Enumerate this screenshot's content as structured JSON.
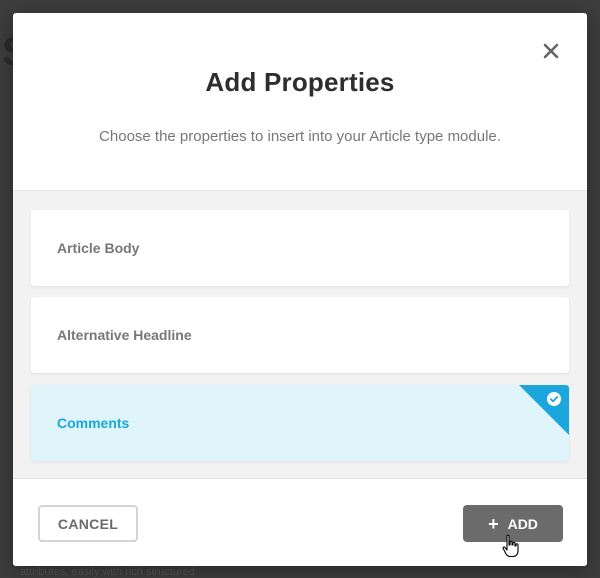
{
  "background": {
    "letter": "S",
    "text": "attributes, easily with rich structured"
  },
  "modal": {
    "title": "Add Properties",
    "subtitle": "Choose the properties to insert into your Article type module.",
    "close_icon": "close-icon"
  },
  "properties": [
    {
      "label": "Article Body",
      "selected": false
    },
    {
      "label": "Alternative Headline",
      "selected": false
    },
    {
      "label": "Comments",
      "selected": true
    }
  ],
  "footer": {
    "cancel_label": "CANCEL",
    "add_label": "ADD",
    "add_icon": "plus-icon"
  },
  "colors": {
    "accent": "#1ba6dd",
    "selected_bg": "#e0f4fc",
    "add_button": "#6b6b6b"
  }
}
